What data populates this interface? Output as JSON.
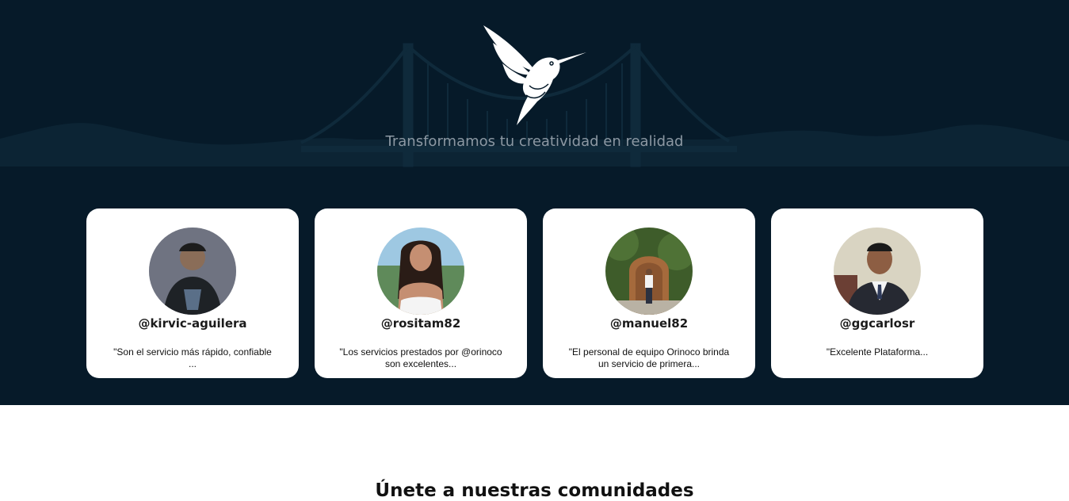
{
  "hero": {
    "tagline": "Transformamos tu creatividad en realidad",
    "background_color": "#061a29",
    "logo_icon": "hummingbird-logo-icon",
    "skyline_icon": "bridge-skyline-icon"
  },
  "testimonials": [
    {
      "handle": "@kirvic-aguilera",
      "quote": "\"Son el servicio más rápido, confiable ...",
      "avatar": "avatar-photo"
    },
    {
      "handle": "@rositam82",
      "quote": "\"Los servicios prestados por @orinoco son excelentes...",
      "avatar": "avatar-photo"
    },
    {
      "handle": "@manuel82",
      "quote": "\"El personal de equipo Orinoco brinda un servicio de primera...",
      "avatar": "avatar-photo"
    },
    {
      "handle": "@ggcarlosr",
      "quote": "\"Excelente Plataforma...",
      "avatar": "avatar-photo"
    }
  ],
  "community": {
    "title": "Únete a nuestras comunidades"
  }
}
